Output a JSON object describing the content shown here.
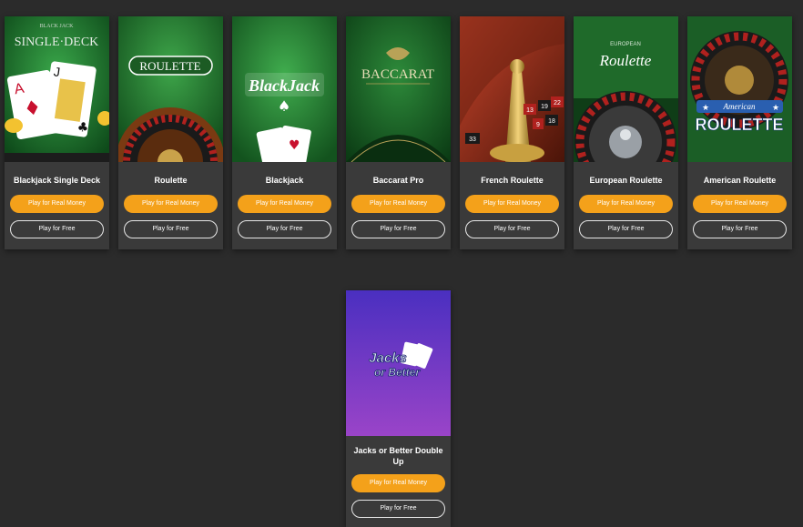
{
  "colors": {
    "page_bg": "#2b2b2b",
    "card_bg": "#3a3a3a",
    "accent": "#f4a11a"
  },
  "games": [
    {
      "title": "Blackjack Single Deck",
      "real_label": "Play for Real Money",
      "free_label": "Play for Free",
      "art": {
        "line1": "BLACK JACK",
        "line2": "SINGLE·DECK"
      }
    },
    {
      "title": "Roulette",
      "real_label": "Play for Real Money",
      "free_label": "Play for Free",
      "art": {
        "line1": "ROULETTE"
      }
    },
    {
      "title": "Blackjack",
      "real_label": "Play for Real Money",
      "free_label": "Play for Free",
      "art": {
        "line1": "BlackJack"
      }
    },
    {
      "title": "Baccarat Pro",
      "real_label": "Play for Real Money",
      "free_label": "Play for Free",
      "art": {
        "line1": "BACCARAT"
      }
    },
    {
      "title": "French Roulette",
      "real_label": "Play for Real Money",
      "free_label": "Play for Free",
      "art": {
        "n1": "33",
        "n2": "13",
        "n3": "19",
        "n4": "22",
        "n5": "9",
        "n6": "18"
      }
    },
    {
      "title": "European Roulette",
      "real_label": "Play for Real Money",
      "free_label": "Play for Free",
      "art": {
        "line1": "EUROPEAN",
        "line2": "Roulette"
      }
    },
    {
      "title": "American Roulette",
      "real_label": "Play for Real Money",
      "free_label": "Play for Free",
      "art": {
        "line1": "American",
        "line2": "ROULETTE"
      }
    },
    {
      "title": "Jacks or Better Double Up",
      "real_label": "Play for Real Money",
      "free_label": "Play for Free",
      "art": {
        "line1": "Jacks",
        "line2": "or Better"
      }
    }
  ]
}
